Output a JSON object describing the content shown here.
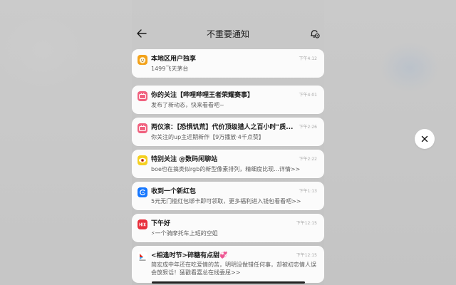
{
  "header": {
    "title": "不重要通知",
    "back_icon": "back-arrow-icon",
    "settings_icon": "notification-settings-icon"
  },
  "notifications": [
    {
      "app_icon": "lion-app-icon",
      "icon_color": "#f3a21a",
      "title": "本地区用户独享",
      "time": "下午4:12",
      "body": "1499飞天茅台"
    },
    {
      "app_icon": "bilibili-icon",
      "icon_color": "#f0627f",
      "title": "你的关注【哔哩哔哩王者荣耀赛事】",
      "time": "下午4:01",
      "body": "发布了新动态，快来看看吧~"
    },
    {
      "app_icon": "bilibili-icon",
      "icon_color": "#f0627f",
      "title": "两仪滚：【恐惧饥荒】代价顶级猎人之百小时\"质...",
      "time": "下午2:26",
      "body": "你关注的up主近期新作【9万播放·4千点赞】"
    },
    {
      "app_icon": "eye-app-icon",
      "icon_color": "#f5d020",
      "title": "特别关注 @数码闲聊站",
      "time": "下午2:22",
      "body": "boe也在搞类似rgb的新型像素排列，精细度比现...详情>>"
    },
    {
      "app_icon": "alipay-icon",
      "icon_color": "#1677ff",
      "title": "收到一个新红包",
      "time": "下午1:13",
      "body": "5元无门槛红包绑卡即可领取，更多福利进入钱包看看吧>>"
    },
    {
      "app_icon": "hello-app-icon",
      "icon_color": "#e8303c",
      "title": "下午好",
      "time": "下午12:15",
      "body": "⚡一个骑摩托车上班的空姐"
    },
    {
      "app_icon": "pinduoduo-icon",
      "icon_color": "#e02e24",
      "title": "<相逢时节>碎糖有点甜💞",
      "time": "下午12:15",
      "body": "简宏成中年还在吃爱情的苦，明明没做错任何事，却被初恋情人误会放狠话！猛戳看嘉总在线委屈>>"
    }
  ],
  "close_icon": "close-icon"
}
